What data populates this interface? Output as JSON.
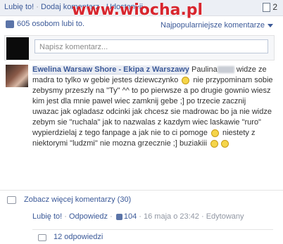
{
  "top_actions": [
    "Lubię to!",
    "Dodaj komentarz",
    "Udostępnij"
  ],
  "watermark": "www.wiocha.pl",
  "share_count": "2",
  "likes_text": "605 osobom lubi to.",
  "sort_label": "Najpopularniejsze komentarze",
  "new_comment_placeholder": "Napisz komentarz...",
  "comment": {
    "author": "Ewelina Warsaw Shore - Ekipa z Warszawy",
    "mention": "Paulina",
    "text1": "widze ze madra to tylko w gebie jestes dziewczynko",
    "text2": "nie przypominam sobie zebysmy przeszly na \"Ty\" ^^ to po pierwsze a po drugie gownio wiesz kim jest dla mnie pawel wiec zamknij gebe ;] po trzecie zacznij uwazac jak ogladasz odcinki jak chcesz sie madrowac bo ja nie widze zebym sie \"ruchala\" jak to nazwalas z kazdym wiec laskawie \"ruro\" wypierdzielaj z tego fanpage a jak nie to ci pomoge",
    "text3": "niestety z niektorymi \"ludzmi\" nie mozna grzecznie ;] buziakiii",
    "meta_like": "Lubię to!",
    "meta_reply": "Odpowiedz",
    "meta_count": "104",
    "meta_date": "16 maja o 23:42",
    "meta_edited": "Edytowany",
    "replies": "12 odpowiedzi"
  },
  "more_comments": "Zobacz więcej komentarzy (30)",
  "icons": [
    "thumbs-up-icon",
    "share-icon",
    "smiley-icon",
    "comment-bubble-icon",
    "caret-down-icon"
  ]
}
